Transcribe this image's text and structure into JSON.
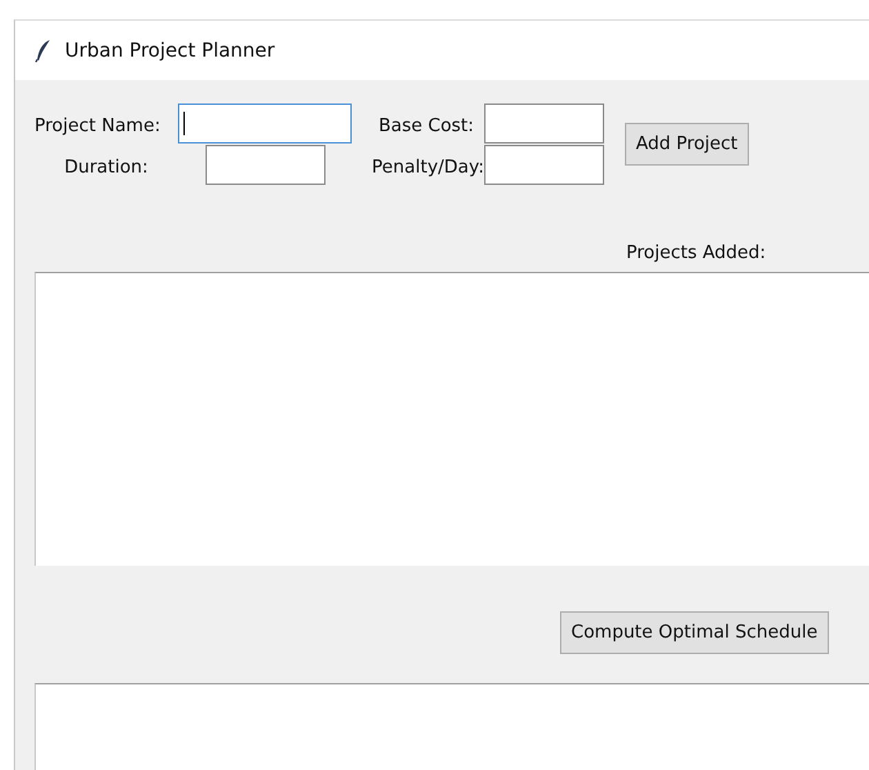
{
  "window": {
    "title": "Urban Project Planner"
  },
  "fields": [
    {
      "label": "Project Name:",
      "focused": true
    },
    {
      "label": "Base Cost:",
      "focused": false
    },
    {
      "label": "Duration:",
      "focused": false
    },
    {
      "label": "Penalty/Day:",
      "focused": false
    }
  ],
  "add_button": "Add Project",
  "projects_label": "Projects Added:",
  "compute_button": "Compute Optimal Schedule"
}
